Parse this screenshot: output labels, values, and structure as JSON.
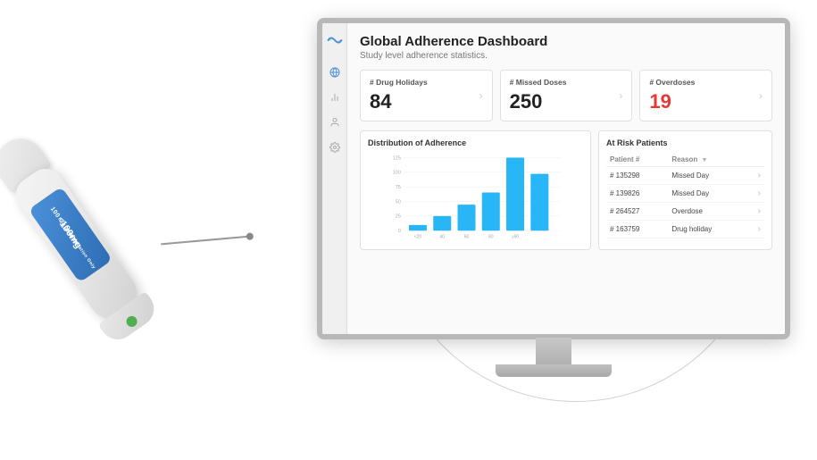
{
  "page": {
    "title": "Global Adherence Dashboard",
    "subtitle": "Study level adherence statistics."
  },
  "stats": [
    {
      "label": "# Drug Holidays",
      "value": "84",
      "red": false
    },
    {
      "label": "# Missed Doses",
      "value": "250",
      "red": false
    },
    {
      "label": "# Overdoses",
      "value": "19",
      "red": true
    }
  ],
  "chart": {
    "title": "Distribution of Adherence",
    "y_labels": [
      "125",
      "100",
      "75",
      "50",
      "25",
      "0"
    ],
    "x_labels": [
      "< 20",
      "40",
      "60",
      "80",
      "≥ 90"
    ],
    "bars": [
      10,
      20,
      35,
      68,
      115,
      90
    ]
  },
  "patients": {
    "title": "At Risk Patients",
    "columns": [
      "Patient #",
      "Reason"
    ],
    "rows": [
      {
        "id": "# 135298",
        "reason": "Missed Day"
      },
      {
        "id": "# 139826",
        "reason": "Missed Day"
      },
      {
        "id": "# 264527",
        "reason": "Overdose"
      },
      {
        "id": "# 163759",
        "reason": "Drug holiday"
      }
    ]
  },
  "sidebar": {
    "icons": [
      "globe",
      "bar-chart",
      "person",
      "settings"
    ]
  },
  "inhaler": {
    "label1": "100 Capsules",
    "label2": "For Oral Inhalation Only",
    "dose": "100mg"
  }
}
